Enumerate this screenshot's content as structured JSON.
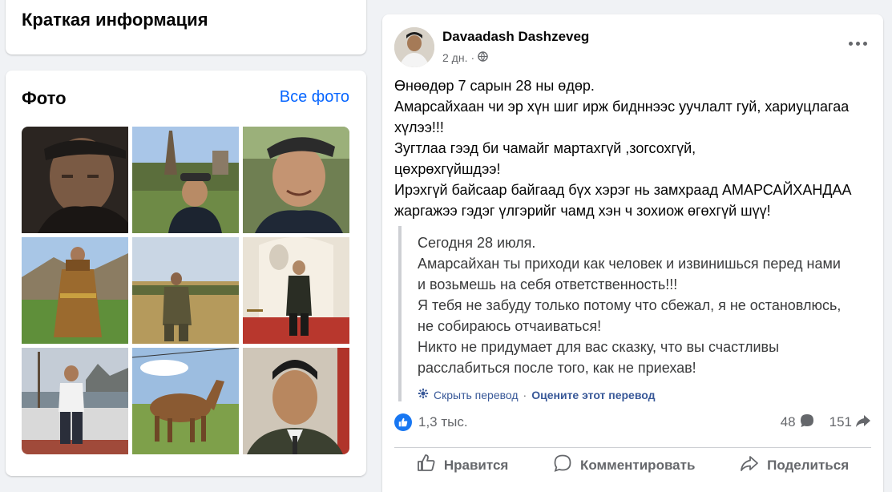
{
  "intro": {
    "title": "Краткая информация"
  },
  "photos": {
    "title": "Фото",
    "all_link": "Все фото",
    "items": [
      "portrait-in-cap",
      "man-in-cap-with-monument",
      "smiling-man-in-cap",
      "man-in-traditional-deel",
      "man-in-camouflage-in-field",
      "man-in-uniform-at-museum",
      "man-on-ship-deck",
      "brown-horse-on-steppe",
      "man-in-military-uniform"
    ]
  },
  "post": {
    "author": "Davaadash Dashzeveg",
    "time": "2 дн.",
    "separator": "·",
    "lines": [
      "Өнөөдөр 7 сарын 28 ны өдөр.",
      "Амарсайхаан чи эр хүн шиг ирж бидннээс уучлалт гуй, хариуцлагаа",
      "хүлээ!!!",
      "Зугтлаа гээд би чамайг мартахгүй ,зогсохгүй,",
      "цөхрөхгүйшдээ!",
      "Ирэхгүй байсаар байгаад бүх хэрэг нь замхраад АМАРСАЙХАНДАА",
      "жаргажээ гэдэг үлгэрийг чамд хэн ч зохиож өгөхгүй шүү!"
    ],
    "translation_lines": [
      "Сегодня 28 июля.",
      "Амарсайхан ты приходи как человек и извинишься перед нами",
      "и возьмешь на себя ответственность!!!",
      "Я тебя не забуду только потому что сбежал, я не остановлюсь,",
      "не собираюсь отчаиваться!",
      "Никто не придумает для вас сказку, что вы счастливы",
      "расслабиться после того, как не приехав!"
    ],
    "hide_translation": "Скрыть перевод",
    "rate_translation": "Оцените этот перевод",
    "reactions": "1,3 тыс.",
    "comments": "48",
    "shares": "151",
    "like_label": "Нравится",
    "comment_label": "Комментировать",
    "share_label": "Поделиться"
  },
  "colors": {
    "accent": "#0866ff",
    "like_blue": "#1877f2",
    "muted": "#65676b",
    "bg": "#f0f2f5"
  }
}
